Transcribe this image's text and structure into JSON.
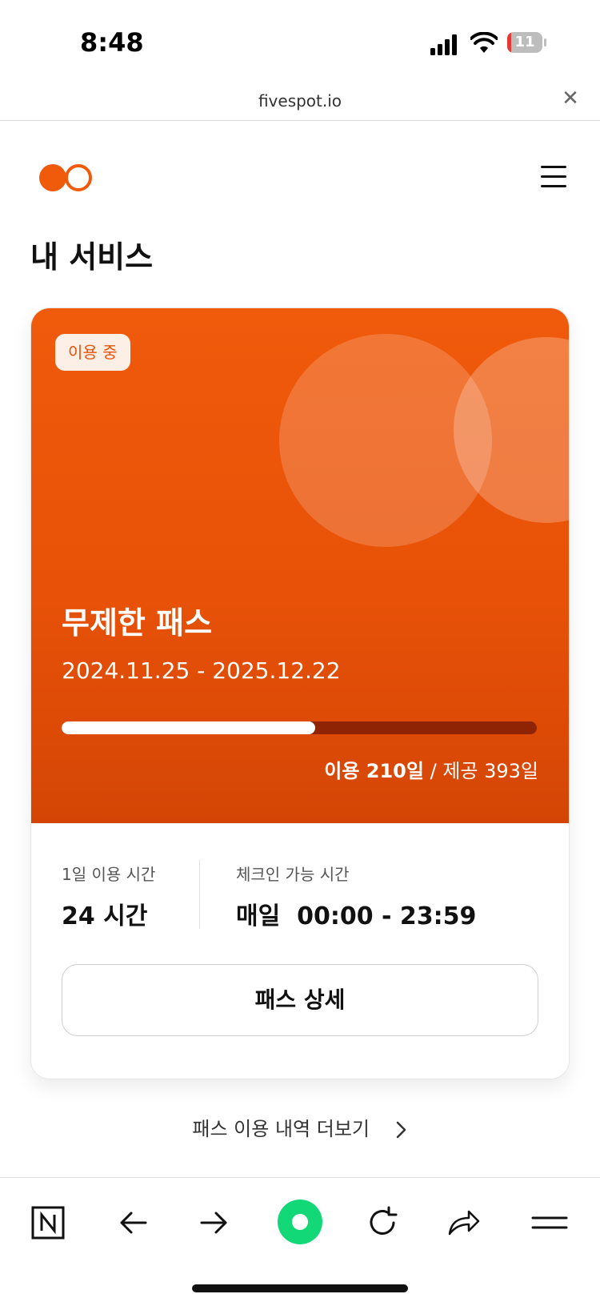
{
  "status_bar": {
    "time": "8:48",
    "battery": "11",
    "battery_level": 0.11
  },
  "browser": {
    "url": "fivespot.io",
    "close_icon": "close-icon"
  },
  "header": {
    "logo": "fivespot-logo",
    "menu_icon": "hamburger-menu-icon"
  },
  "page": {
    "title": "내 서비스"
  },
  "pass_card": {
    "badge": "이용 중",
    "name": "무제한 패스",
    "dates": "2024.11.25 - 2025.12.22",
    "used_days_label": "이용 210일",
    "separator": "/",
    "total_days_label": "제공 393일",
    "used_days": 210,
    "total_days": 393,
    "accent_color": "#e85208",
    "daily_usage": {
      "label": "1일 이용 시간",
      "value": "24 시간"
    },
    "checkin": {
      "label": "체크인 가능 시간",
      "value": "매일  00:00 - 23:59"
    },
    "detail_button": "패스 상세"
  },
  "more_link": {
    "label": "패스 이용 내역 더보기"
  },
  "toolbar": {
    "items": [
      "naver-n-icon",
      "back-arrow-icon",
      "forward-arrow-icon",
      "green-dot-icon",
      "refresh-icon",
      "share-icon",
      "menu-icon"
    ]
  }
}
